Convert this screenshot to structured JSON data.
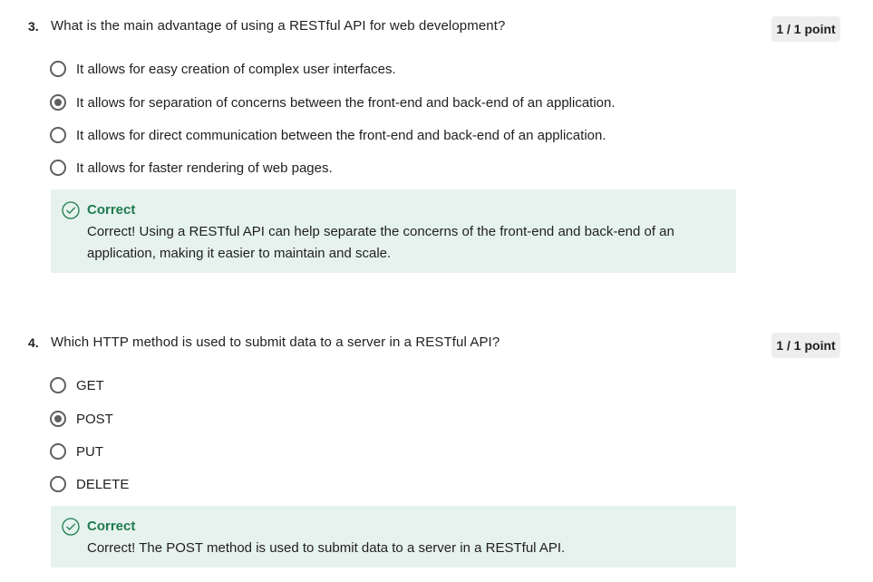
{
  "colors": {
    "correct": "#1e7b4d",
    "feedback_bg": "#e6f2ee",
    "points_bg": "#eeeeee"
  },
  "questions": [
    {
      "number": "3.",
      "text": "What is the main advantage of using a RESTful API for web development?",
      "points": "1 / 1 point",
      "options": [
        {
          "label": "It allows for easy creation of complex user interfaces.",
          "selected": false
        },
        {
          "label": "It allows for separation of concerns between the front-end and back-end of an application.",
          "selected": true
        },
        {
          "label": "It allows for direct communication between the front-end and back-end of an application.",
          "selected": false
        },
        {
          "label": "It allows for faster rendering of web pages.",
          "selected": false
        }
      ],
      "feedback": {
        "icon": "check-circle-icon",
        "title": "Correct",
        "text": "Correct! Using a RESTful API can help separate the concerns of the front-end and back-end of an application, making it easier to maintain and scale."
      }
    },
    {
      "number": "4.",
      "text": "Which HTTP method is used to submit data to a server in a RESTful API?",
      "points": "1 / 1 point",
      "options": [
        {
          "label": "GET",
          "selected": false
        },
        {
          "label": "POST",
          "selected": true
        },
        {
          "label": "PUT",
          "selected": false
        },
        {
          "label": "DELETE",
          "selected": false
        }
      ],
      "feedback": {
        "icon": "check-circle-icon",
        "title": "Correct",
        "text": "Correct! The POST method is used to submit data to a server in a RESTful API."
      }
    }
  ]
}
